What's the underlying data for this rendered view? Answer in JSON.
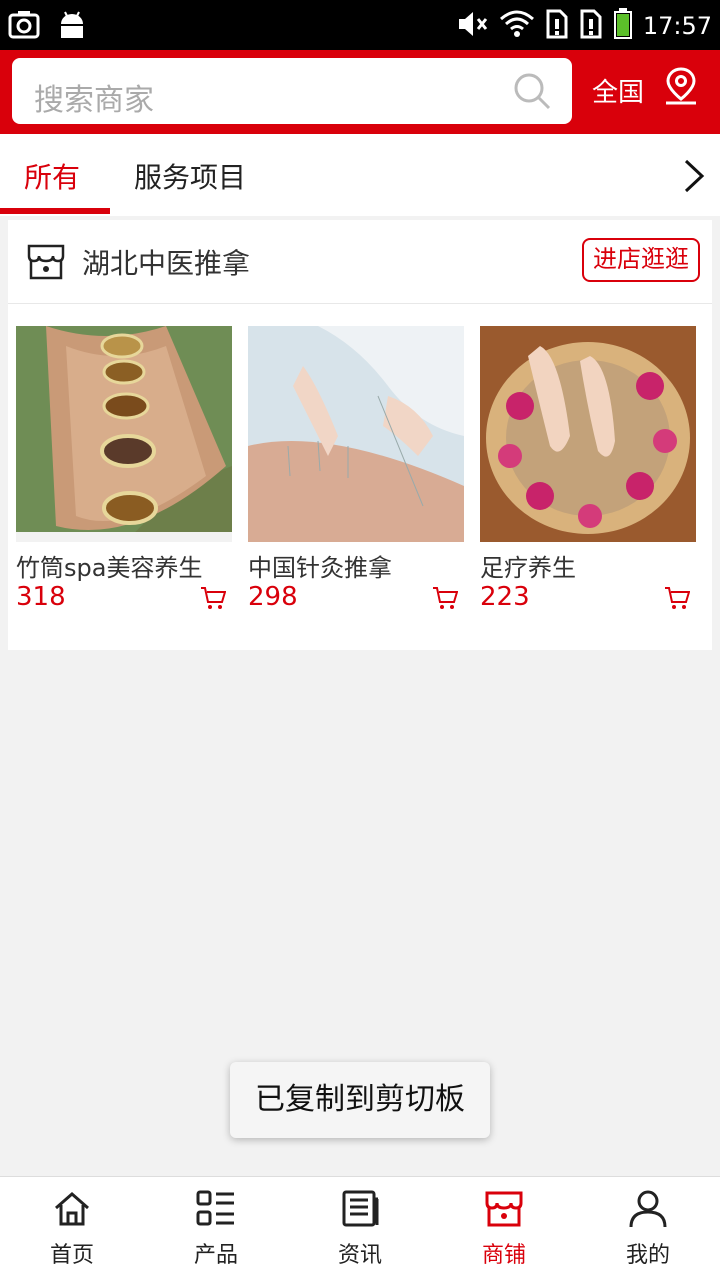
{
  "status_bar": {
    "time": "17:57",
    "icons": [
      "screenshot-icon",
      "android-icon",
      "mute-icon",
      "wifi-icon",
      "sim-alert-icon",
      "sim-alert-icon",
      "battery-icon"
    ]
  },
  "header": {
    "search_placeholder": "搜索商家",
    "region_label": "全国",
    "brand_color": "#d9000b"
  },
  "tabs": [
    {
      "label": "所有",
      "active": true
    },
    {
      "label": "服务项目",
      "active": false
    }
  ],
  "shop": {
    "name": "湖北中医推拿",
    "enter_label": "进店逛逛",
    "products": [
      {
        "name": "竹筒spa美容养生",
        "price": "318"
      },
      {
        "name": "中国针灸推拿",
        "price": "298"
      },
      {
        "name": "足疗养生",
        "price": "223"
      }
    ]
  },
  "toast": "已复制到剪切板",
  "bottom_nav": [
    {
      "label": "首页",
      "icon": "home-icon",
      "active": false
    },
    {
      "label": "产品",
      "icon": "grid-list-icon",
      "active": false
    },
    {
      "label": "资讯",
      "icon": "news-icon",
      "active": false
    },
    {
      "label": "商铺",
      "icon": "store-icon",
      "active": true
    },
    {
      "label": "我的",
      "icon": "user-icon",
      "active": false
    }
  ]
}
